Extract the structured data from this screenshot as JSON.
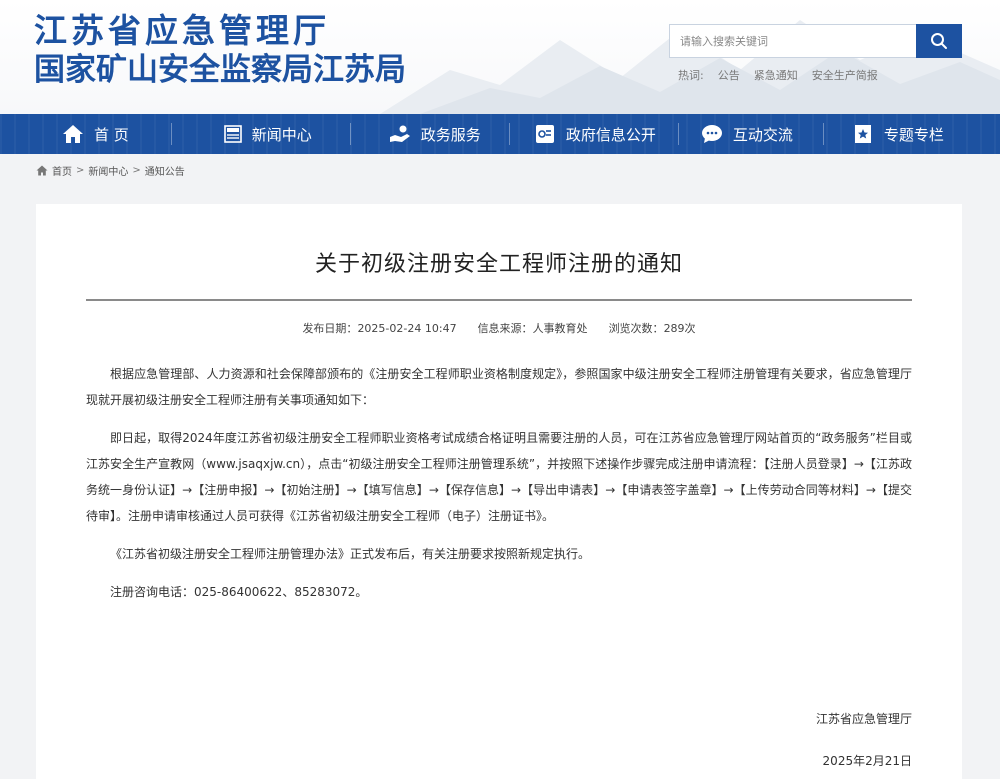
{
  "header": {
    "logo_line1": "江苏省应急管理厅",
    "logo_line2": "国家矿山安全监察局江苏局",
    "search": {
      "placeholder": "请输入搜索关键词",
      "icon": "search-icon"
    },
    "hot_words": {
      "label": "热词:",
      "items": [
        "公告",
        "紧急通知",
        "安全生产简报"
      ]
    }
  },
  "nav": {
    "items": [
      {
        "label": "首 页",
        "icon": "home-icon"
      },
      {
        "label": "新闻中心",
        "icon": "news-icon"
      },
      {
        "label": "政务服务",
        "icon": "service-icon"
      },
      {
        "label": "政府信息公开",
        "icon": "info-icon"
      },
      {
        "label": "互动交流",
        "icon": "chat-icon"
      },
      {
        "label": "专题专栏",
        "icon": "star-icon"
      }
    ]
  },
  "breadcrumb": {
    "icon": "home-icon",
    "items": [
      "首页",
      "新闻中心",
      "通知公告"
    ],
    "separator": ">"
  },
  "article": {
    "title": "关于初级注册安全工程师注册的通知",
    "meta": {
      "date_label": "发布日期：",
      "date": "2025-02-24 10:47",
      "source_label": "信息来源：",
      "source": "人事教育处",
      "views_label": "浏览次数：",
      "views": "289次"
    },
    "paragraphs": [
      "根据应急管理部、人力资源和社会保障部颁布的《注册安全工程师职业资格制度规定》，参照国家中级注册安全工程师注册管理有关要求，省应急管理厅现就开展初级注册安全工程师注册有关事项通知如下：",
      "即日起，取得2024年度江苏省初级注册安全工程师职业资格考试成绩合格证明且需要注册的人员，可在江苏省应急管理厅网站首页的“政务服务”栏目或江苏安全生产宣教网（www.jsaqxjw.cn），点击“初级注册安全工程师注册管理系统”，并按照下述操作步骤完成注册申请流程：【注册人员登录】→【江苏政务统一身份认证】→【注册申报】→【初始注册】→【填写信息】→【保存信息】→【导出申请表】→【申请表签字盖章】→【上传劳动合同等材料】→【提交待审】。注册申请审核通过人员可获得《江苏省初级注册安全工程师（电子）注册证书》。",
      "《江苏省初级注册安全工程师注册管理办法》正式发布后，有关注册要求按照新规定执行。",
      "注册咨询电话：025-86400622、85283072。"
    ],
    "signature": "江苏省应急管理厅",
    "sign_date": "2025年2月21日"
  },
  "colors": {
    "brand": "#1d52a1",
    "nav_bg": "#1d52a1",
    "page_bg": "#f2f3f5"
  }
}
